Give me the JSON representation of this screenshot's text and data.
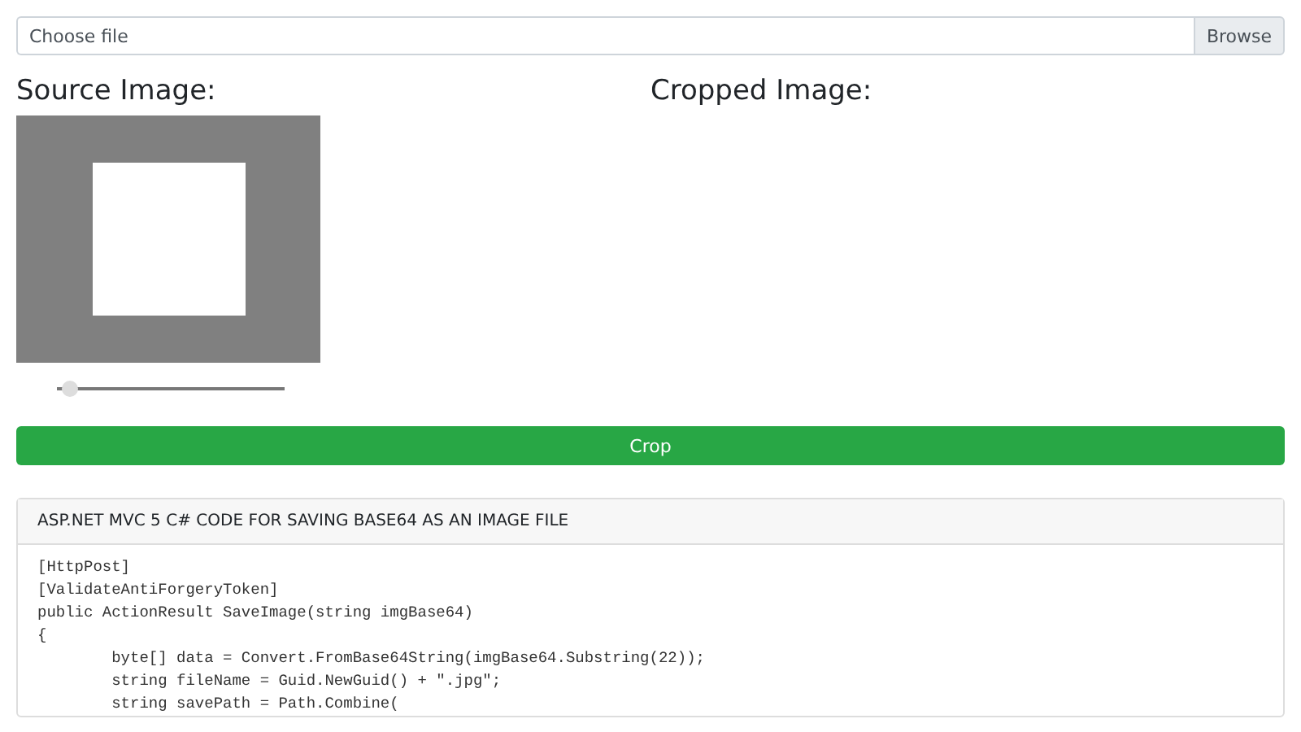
{
  "file_input": {
    "placeholder": "Choose file",
    "button": "Browse"
  },
  "source": {
    "heading": "Source Image:",
    "zoom_slider": {
      "level": 0.03
    }
  },
  "cropped": {
    "heading": "Cropped Image:"
  },
  "crop_button": "Crop",
  "code_card": {
    "title": "ASP.NET MVC 5 C# CODE FOR SAVING BASE64 AS AN IMAGE FILE",
    "code_lines": [
      "[HttpPost]",
      "[ValidateAntiForgeryToken]",
      "public ActionResult SaveImage(string imgBase64)",
      "{",
      "        byte[] data = Convert.FromBase64String(imgBase64.Substring(22));",
      "        string fileName = Guid.NewGuid() + \".jpg\";",
      "        string savePath = Path.Combine("
    ]
  }
}
